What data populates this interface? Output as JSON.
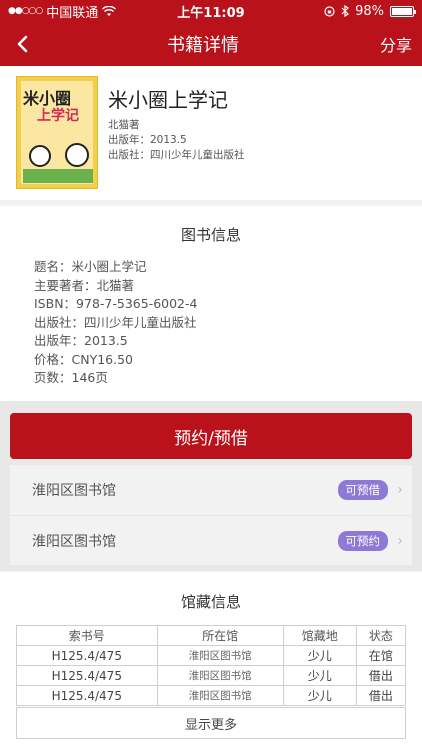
{
  "status_bar": {
    "signal": "●●○○○",
    "carrier": "中国联通",
    "wifi_icon": "wifi-icon",
    "time": "上午11:09",
    "battery": "98%",
    "battery_level": 0.98
  },
  "nav": {
    "back_icon": "chevron-left-icon",
    "title": "书籍详情",
    "share_label": "分享"
  },
  "book": {
    "title": "米小圈上学记",
    "author": "北猫著",
    "year": "出版年：2013.5",
    "publisher": "出版社：四川少年儿童出版社",
    "cover_text": "米小圈 上学记"
  },
  "book_info": {
    "heading": "图书信息",
    "items": [
      "题名：米小圈上学记",
      "主要著者：北猫著",
      "ISBN：978-7-5365-6002-4",
      "出版社：四川少年儿童出版社",
      "出版年：2013.5",
      "价格：CNY16.50",
      "页数：146页"
    ]
  },
  "reserve": {
    "button_label": "预约/预借",
    "libraries": [
      {
        "name": "淮阳区图书馆",
        "status": "可预借"
      },
      {
        "name": "淮阳区图书馆",
        "status": "可预约"
      }
    ],
    "badge_color": "#8e7ad6"
  },
  "holdings": {
    "heading": "馆藏信息",
    "columns": [
      "索书号",
      "所在馆",
      "馆藏地",
      "状态"
    ],
    "rows": [
      [
        "H125.4/475",
        "淮阳区图书馆",
        "少儿",
        "在馆"
      ],
      [
        "H125.4/475",
        "淮阳区图书馆",
        "少儿",
        "借出"
      ],
      [
        "H125.4/475",
        "淮阳区图书馆",
        "少儿",
        "借出"
      ]
    ],
    "show_more_label": "显示更多"
  },
  "colors": {
    "brand": "#b9121b",
    "background": "#f2f2f2"
  }
}
